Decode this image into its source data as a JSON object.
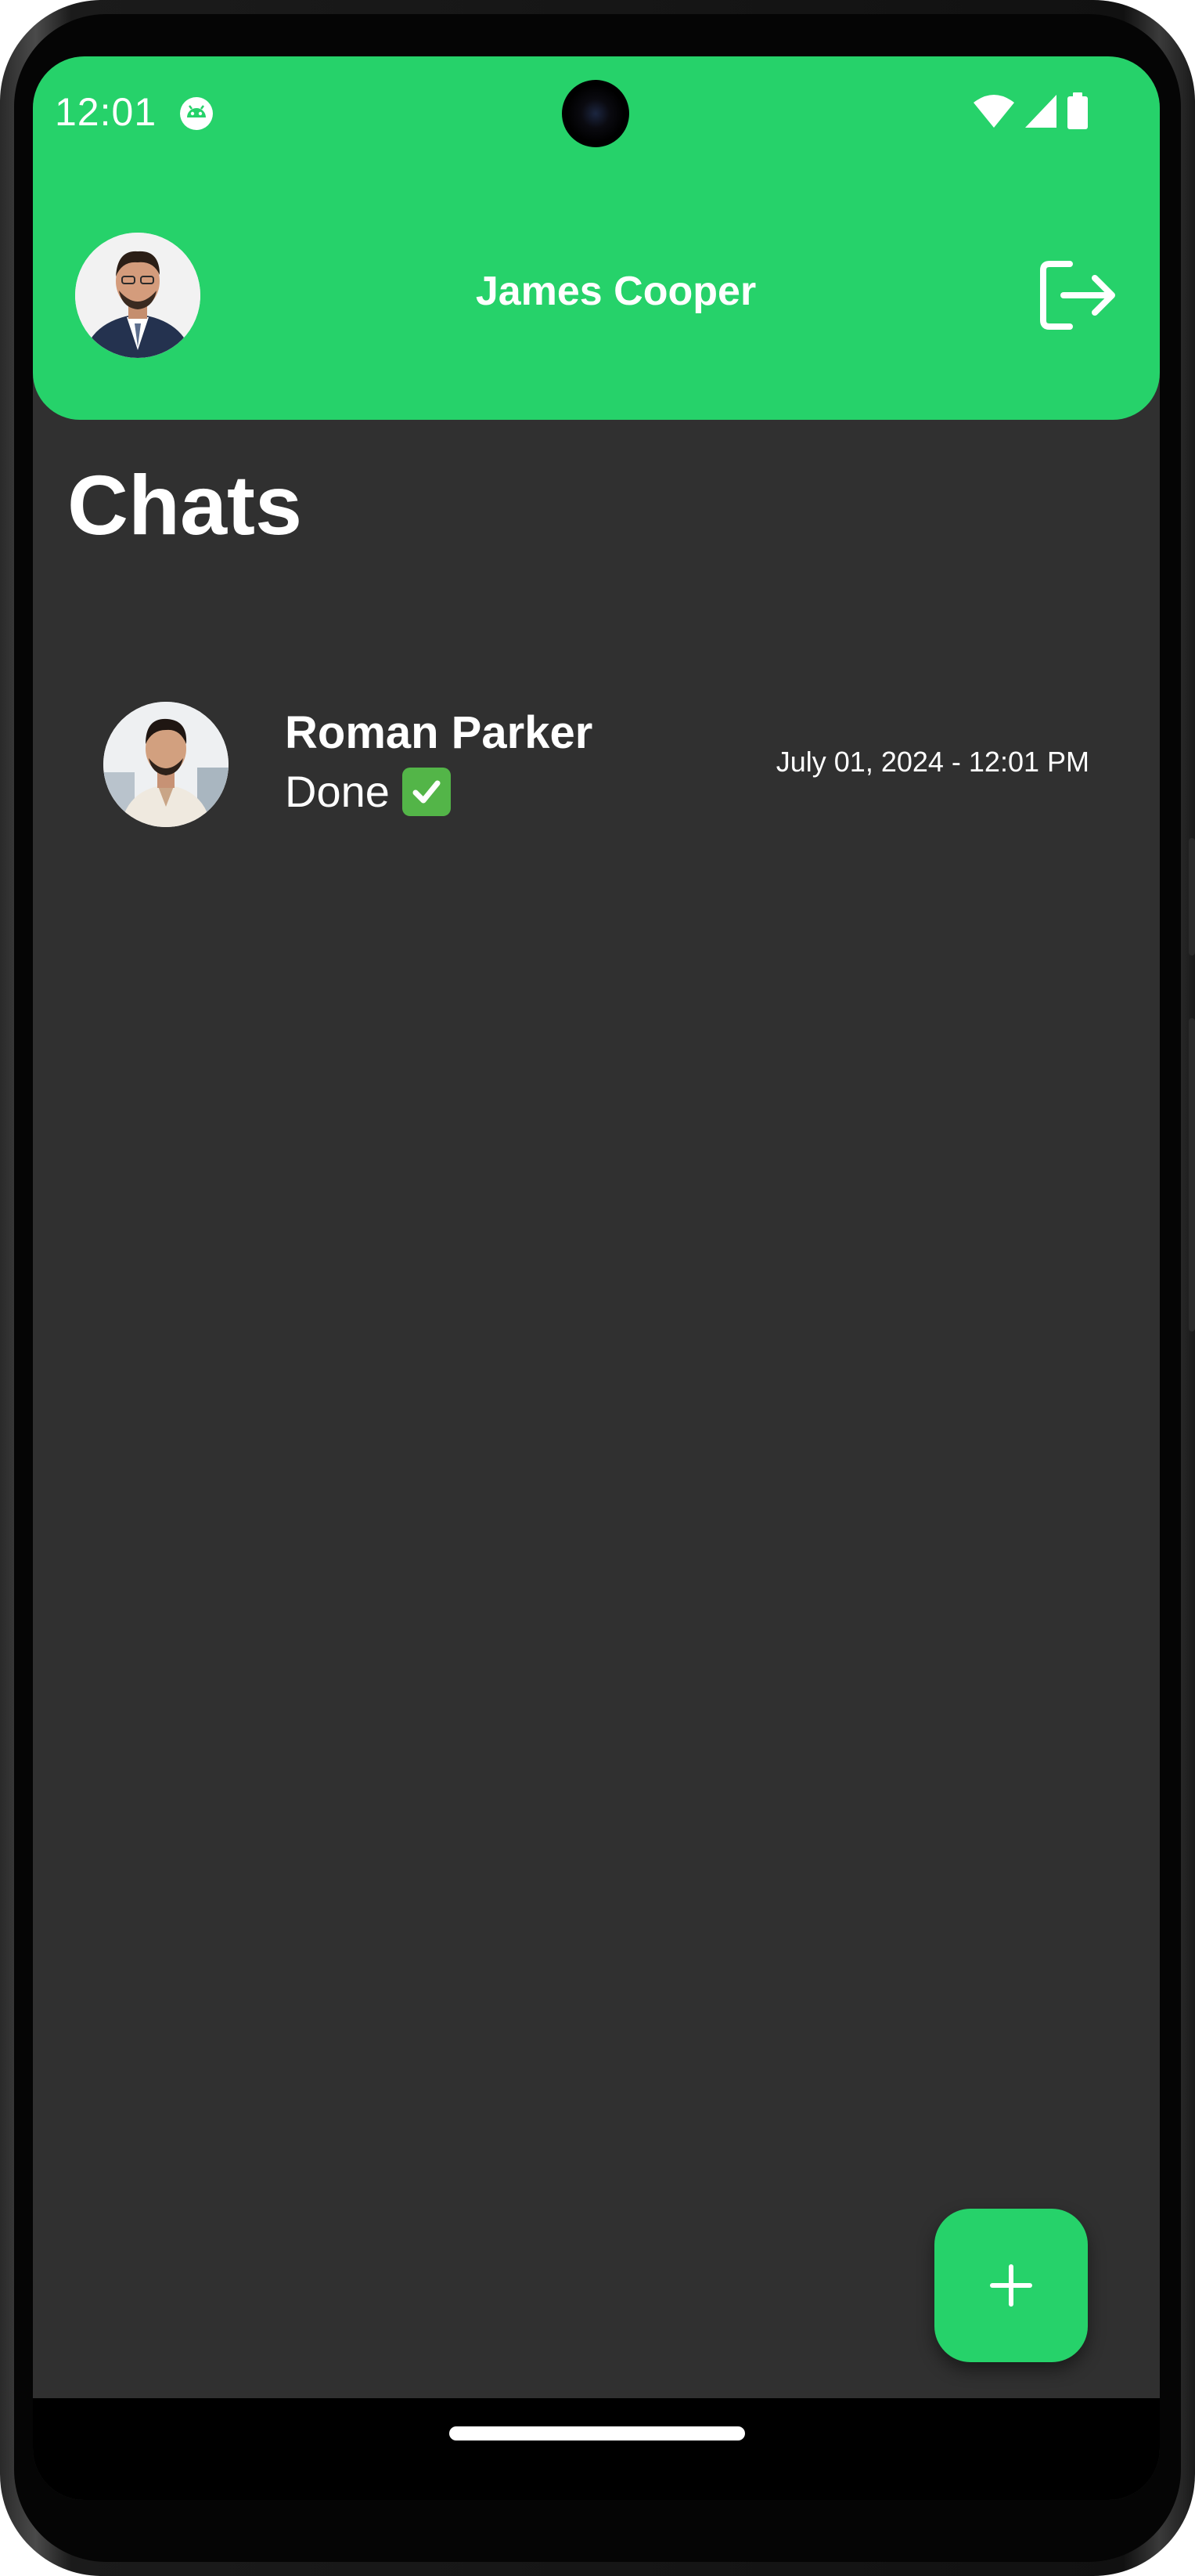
{
  "status_bar": {
    "time": "12:01",
    "icons": [
      "android-app-icon",
      "wifi-icon",
      "signal-icon",
      "battery-icon"
    ]
  },
  "app_bar": {
    "title": "James Cooper",
    "avatar": "profile-avatar",
    "logout_icon": "logout-icon"
  },
  "page": {
    "title": "Chats"
  },
  "chats": [
    {
      "name": "Roman Parker",
      "last_message": "Done",
      "emoji": "check-mark-emoji",
      "timestamp": "July 01, 2024 - 12:01 PM"
    }
  ],
  "fab": {
    "icon": "plus-icon"
  },
  "colors": {
    "primary": "#26d26a",
    "background": "#303030",
    "text": "#ffffff"
  }
}
